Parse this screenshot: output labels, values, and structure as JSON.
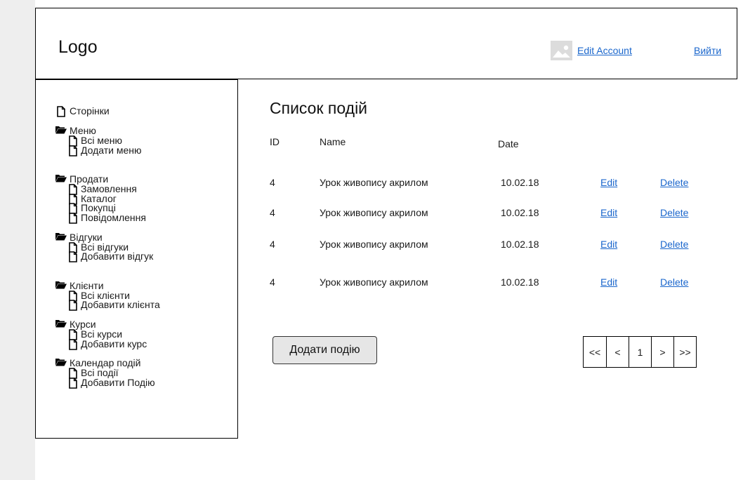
{
  "header": {
    "logo": "Logo",
    "edit_account": "Edit Account",
    "logout": "Вийти"
  },
  "sidebar": {
    "pages": "Сторінки",
    "sections": [
      {
        "label": "Меню",
        "items": [
          "Всі меню",
          "Додати меню"
        ]
      },
      {
        "label": "Продати",
        "items": [
          "Замовлення",
          "Каталог",
          "Покупці",
          "Повідомлення"
        ]
      },
      {
        "label": "Відгуки",
        "items": [
          "Всі відгуки",
          "Добавити відгук"
        ]
      },
      {
        "label": "Клієнти",
        "items": [
          "Всі клієнти",
          "Добавити клієнта"
        ]
      },
      {
        "label": "Курси",
        "items": [
          "Всі курси",
          "Добавити курс"
        ]
      },
      {
        "label": "Календар подій",
        "items": [
          "Всі події",
          "Добавити Подію"
        ]
      }
    ]
  },
  "main": {
    "title": "Список подій",
    "columns": {
      "id": "ID",
      "name": "Name",
      "date": "Date"
    },
    "rows": [
      {
        "id": "4",
        "name": "Урок живопису акрилом",
        "date": "10.02.18",
        "edit": "Edit",
        "delete": "Delete"
      },
      {
        "id": "4",
        "name": "Урок живопису акрилом",
        "date": "10.02.18",
        "edit": "Edit",
        "delete": "Delete"
      },
      {
        "id": "4",
        "name": "Урок живопису акрилом",
        "date": "10.02.18",
        "edit": "Edit",
        "delete": "Delete"
      },
      {
        "id": "4",
        "name": "Урок живопису акрилом",
        "date": "10.02.18",
        "edit": "Edit",
        "delete": "Delete"
      }
    ],
    "add_button": "Додати подію",
    "pagination": {
      "first": "<<",
      "prev": "<",
      "page": "1",
      "next": ">",
      "last": ">>"
    }
  }
}
